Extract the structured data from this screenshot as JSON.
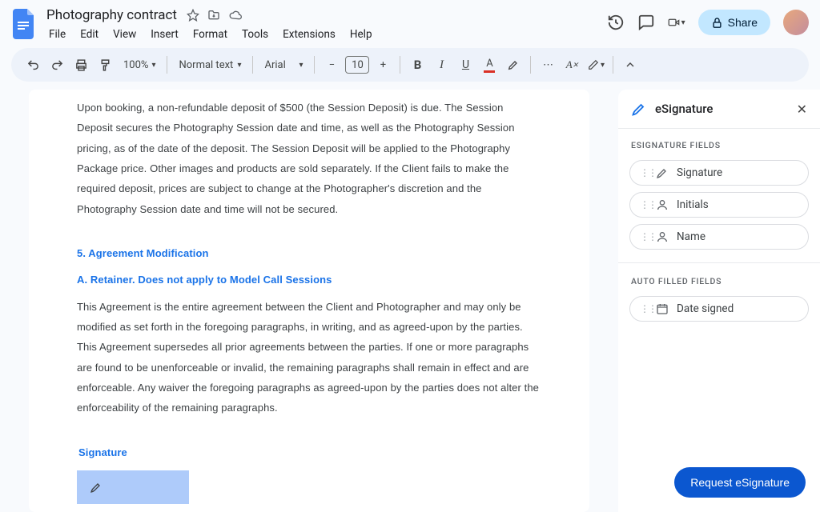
{
  "header": {
    "title": "Photography contract",
    "menus": [
      "File",
      "Edit",
      "View",
      "Insert",
      "Format",
      "Tools",
      "Extensions",
      "Help"
    ],
    "share_label": "Share"
  },
  "toolbar": {
    "zoom": "100%",
    "style": "Normal text",
    "font": "Arial",
    "font_size": "10"
  },
  "document": {
    "para1": "Upon booking, a non-refundable deposit of $500 (the Session Deposit) is due. The Session Deposit secures the Photography Session date and time, as well as the Photography Session pricing, as of the date of the deposit. The Session Deposit will be applied to the Photography Package price. Other images and products are sold separately. If the Client fails to make the required deposit, prices are subject to change at the Photographer's discretion and the Photography Session date and time will not be secured.",
    "heading5": "5. Agreement Modification",
    "heading5a": "A. Retainer.  Does not apply to Model Call Sessions",
    "para2": "This Agreement is the entire agreement between the Client and Photographer and may only be modified as set forth in the foregoing paragraphs, in writing, and as agreed-upon by the parties.  This Agreement supersedes all prior agreements between the parties. If one or more paragraphs are found to be unenforceable or invalid, the remaining paragraphs shall remain in effect and are enforceable. Any waiver the foregoing paragraphs as agreed-upon by the parties does not alter the enforceability of the remaining paragraphs.",
    "signature_label": "Signature"
  },
  "sidepanel": {
    "title": "eSignature",
    "section1": "ESIGNATURE FIELDS",
    "fields": [
      "Signature",
      "Initials",
      "Name"
    ],
    "section2": "AUTO FILLED FIELDS",
    "auto_fields": [
      "Date signed"
    ],
    "request_label": "Request eSignature"
  }
}
